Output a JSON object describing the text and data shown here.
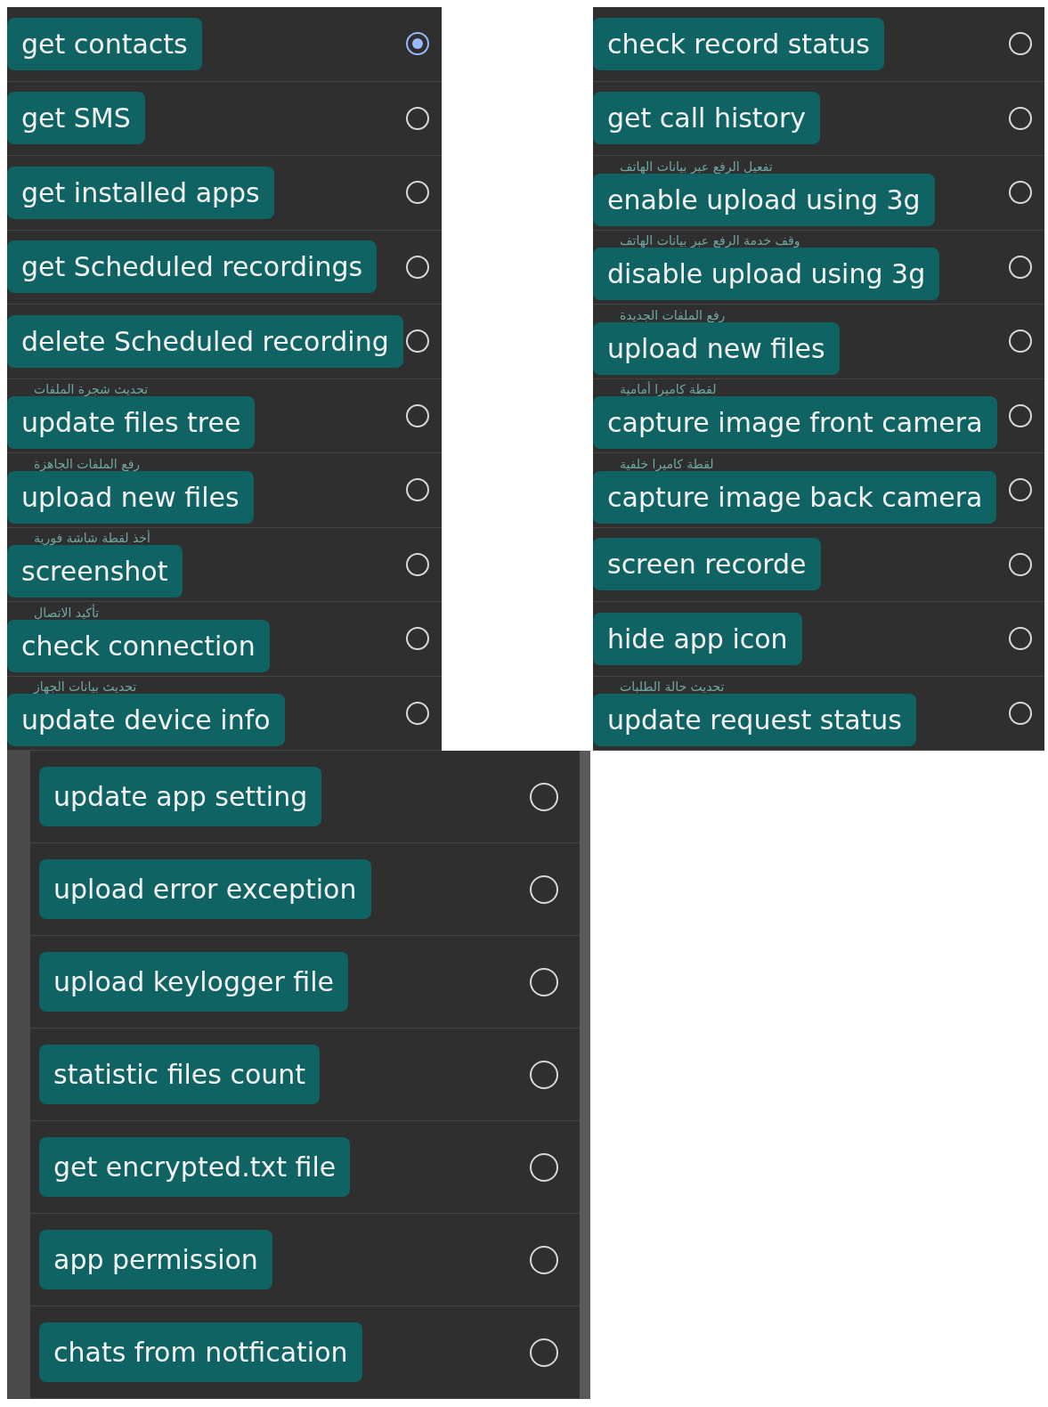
{
  "panels": [
    {
      "rows": [
        {
          "label": "get contacts",
          "selected": true
        },
        {
          "label": "get SMS",
          "selected": false
        },
        {
          "label": "get installed apps",
          "selected": false
        },
        {
          "label": "get Scheduled recordings",
          "selected": false
        },
        {
          "label": "delete Scheduled recording",
          "selected": false
        },
        {
          "label": "update files tree",
          "subtitle": "تحديث شجرة الملفات",
          "selected": false
        },
        {
          "label": "upload new files",
          "subtitle": "رفع الملفات الجاهزة",
          "selected": false
        },
        {
          "label": "screenshot",
          "subtitle": "أخذ لقطة شاشة فورية",
          "selected": false
        },
        {
          "label": "check connection",
          "subtitle": "تأكيد الاتصال",
          "selected": false
        },
        {
          "label": "update device info",
          "subtitle": "تحديث بيانات الجهاز",
          "selected": false
        }
      ]
    },
    {
      "rows": [
        {
          "label": "check record status",
          "selected": false
        },
        {
          "label": "get call history",
          "selected": false
        },
        {
          "label": "enable upload using 3g",
          "subtitle": "تفعيل الرفع عبر بيانات الهاتف",
          "selected": false
        },
        {
          "label": "disable upload using 3g",
          "subtitle": "وقف خدمة الرفع عبر بيانات الهاتف",
          "selected": false
        },
        {
          "label": "upload new files",
          "subtitle": "رفع الملفات الجديدة",
          "selected": false
        },
        {
          "label": "capture image front camera",
          "subtitle": "لقطة كاميرا أمامية",
          "selected": false
        },
        {
          "label": "capture image back camera",
          "subtitle": "لقطة كاميرا خلفية",
          "selected": false
        },
        {
          "label": "screen recorde",
          "selected": false
        },
        {
          "label": "hide app icon",
          "selected": false
        },
        {
          "label": "update request status",
          "subtitle": "تحديث حالة الطلبات",
          "selected": false
        }
      ]
    },
    {
      "rows": [
        {
          "label": "update app setting",
          "selected": false
        },
        {
          "label": "upload error exception",
          "selected": false
        },
        {
          "label": "upload keylogger file",
          "selected": false
        },
        {
          "label": "statistic files count",
          "selected": false
        },
        {
          "label": "get encrypted.txt file",
          "selected": false
        },
        {
          "label": "app permission",
          "selected": false
        },
        {
          "label": "chats from notfication",
          "selected": false
        }
      ]
    }
  ]
}
